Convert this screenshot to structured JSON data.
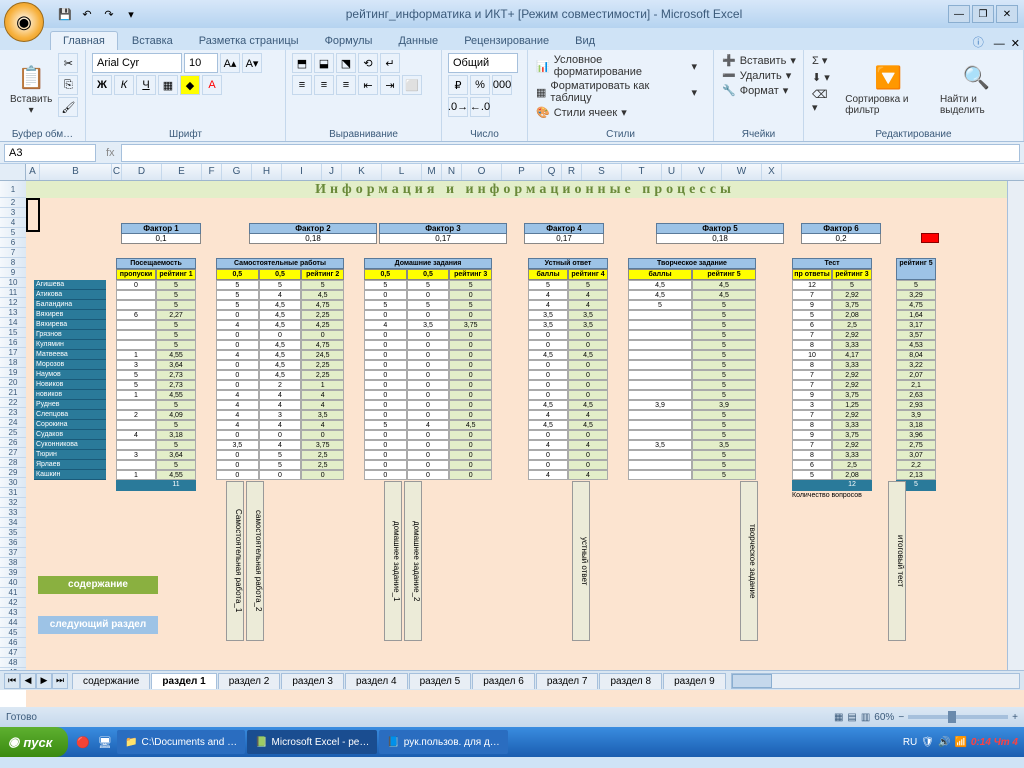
{
  "title": "рейтинг_информатика и ИКТ+  [Режим совместимости] - Microsoft Excel",
  "tabs": {
    "home": "Главная",
    "insert": "Вставка",
    "layout": "Разметка страницы",
    "formulas": "Формулы",
    "data": "Данные",
    "review": "Рецензирование",
    "view": "Вид"
  },
  "groups": {
    "clipboard": "Буфер обм…",
    "paste": "Вставить",
    "font": "Шрифт",
    "align": "Выравнивание",
    "number": "Число",
    "styles": "Стили",
    "cells": "Ячейки",
    "editing": "Редактирование"
  },
  "font": {
    "name": "Arial Cyr",
    "size": "10"
  },
  "numfmt": "Общий",
  "styles": {
    "cond": "Условное форматирование",
    "table": "Форматировать как таблицу",
    "cell": "Стили ячеек"
  },
  "cells": {
    "insert": "Вставить",
    "delete": "Удалить",
    "format": "Формат"
  },
  "edit": {
    "sort": "Сортировка и фильтр",
    "find": "Найти и выделить"
  },
  "namebox": "A3",
  "cols": [
    "A",
    "B",
    "C",
    "D",
    "E",
    "F",
    "G",
    "H",
    "I",
    "J",
    "K",
    "L",
    "M",
    "N",
    "O",
    "P",
    "Q",
    "R",
    "S",
    "T",
    "U",
    "V",
    "W",
    "X"
  ],
  "maintitle": "Информация  и  информационные   процессы",
  "factors": [
    {
      "label": "Фактор 1",
      "val": "0,1"
    },
    {
      "label": "Фактор 2",
      "val": "0,18"
    },
    {
      "label": "Фактор 3",
      "val": "0,17"
    },
    {
      "label": "Фактор 4",
      "val": "0,17"
    },
    {
      "label": "Фактор 5",
      "val": "0,18"
    },
    {
      "label": "Фактор 6",
      "val": "0,2"
    }
  ],
  "names": [
    "Агишева",
    "Атикова",
    "Баландина",
    "Вяхирев",
    "Вяхирева",
    "Грязнов",
    "Кулямин",
    "Матвеева",
    "Морозов",
    "Наумов",
    "Новиков",
    "новиков",
    "Руднев",
    "Слепцова",
    "Сорокина",
    "Судаков",
    "Суконникова",
    "Тюрин",
    "Ярлаев",
    "Кашкин"
  ],
  "t1": {
    "hdr": "Посещаемость",
    "sub": [
      "пропуски",
      "рейтинг 1"
    ],
    "foot": [
      "",
      "11"
    ],
    "rows": [
      [
        "0",
        "5"
      ],
      [
        "",
        "5"
      ],
      [
        "",
        "5"
      ],
      [
        "6",
        "2,27"
      ],
      [
        "",
        "5"
      ],
      [
        "",
        "5"
      ],
      [
        "",
        "5"
      ],
      [
        "1",
        "4,55"
      ],
      [
        "3",
        "3,64"
      ],
      [
        "5",
        "2,73"
      ],
      [
        "5",
        "2,73"
      ],
      [
        "1",
        "4,55"
      ],
      [
        "",
        "5"
      ],
      [
        "2",
        "4,09"
      ],
      [
        "",
        "5"
      ],
      [
        "4",
        "3,18"
      ],
      [
        "",
        "5"
      ],
      [
        "3",
        "3,64"
      ],
      [
        "",
        "5"
      ],
      [
        "1",
        "4,55"
      ]
    ]
  },
  "t2": {
    "hdr": "Самостоятельные работы",
    "sub": [
      "0,5",
      "0,5",
      "рейтинг 2"
    ],
    "rows": [
      [
        "5",
        "5",
        "5"
      ],
      [
        "5",
        "4",
        "4,5"
      ],
      [
        "5",
        "4,5",
        "4,75"
      ],
      [
        "0",
        "4,5",
        "2,25"
      ],
      [
        "4",
        "4,5",
        "4,25"
      ],
      [
        "0",
        "0",
        "0"
      ],
      [
        "0",
        "4,5",
        "4,75"
      ],
      [
        "4",
        "4,5",
        "24,5"
      ],
      [
        "0",
        "4,5",
        "2,25"
      ],
      [
        "0",
        "4,5",
        "2,25"
      ],
      [
        "0",
        "2",
        "1"
      ],
      [
        "4",
        "4",
        "4"
      ],
      [
        "4",
        "4",
        "4"
      ],
      [
        "4",
        "3",
        "3,5"
      ],
      [
        "4",
        "4",
        "4"
      ],
      [
        "0",
        "0",
        "0"
      ],
      [
        "3,5",
        "4",
        "3,75"
      ],
      [
        "0",
        "5",
        "2,5"
      ],
      [
        "0",
        "5",
        "2,5"
      ],
      [
        "0",
        "0",
        "0"
      ]
    ]
  },
  "t3": {
    "hdr": "Домашние задания",
    "sub": [
      "0,5",
      "0,5",
      "рейтинг 3"
    ],
    "rows": [
      [
        "5",
        "5",
        "5"
      ],
      [
        "0",
        "0",
        "0"
      ],
      [
        "5",
        "5",
        "5"
      ],
      [
        "0",
        "0",
        "0"
      ],
      [
        "4",
        "3,5",
        "3,75"
      ],
      [
        "0",
        "0",
        "0"
      ],
      [
        "0",
        "0",
        "0"
      ],
      [
        "0",
        "0",
        "0"
      ],
      [
        "0",
        "0",
        "0"
      ],
      [
        "0",
        "0",
        "0"
      ],
      [
        "0",
        "0",
        "0"
      ],
      [
        "0",
        "0",
        "0"
      ],
      [
        "0",
        "0",
        "0"
      ],
      [
        "0",
        "0",
        "0"
      ],
      [
        "5",
        "4",
        "4,5"
      ],
      [
        "0",
        "0",
        "0"
      ],
      [
        "0",
        "0",
        "0"
      ],
      [
        "0",
        "0",
        "0"
      ],
      [
        "0",
        "0",
        "0"
      ],
      [
        "0",
        "0",
        "0"
      ]
    ]
  },
  "t4": {
    "hdr": "Устный ответ",
    "sub": [
      "баллы",
      "рейтинг 4"
    ],
    "rows": [
      [
        "5",
        "5"
      ],
      [
        "4",
        "4"
      ],
      [
        "4",
        "4"
      ],
      [
        "3,5",
        "3,5"
      ],
      [
        "3,5",
        "3,5"
      ],
      [
        "0",
        "0"
      ],
      [
        "0",
        "0"
      ],
      [
        "4,5",
        "4,5"
      ],
      [
        "0",
        "0"
      ],
      [
        "0",
        "0"
      ],
      [
        "0",
        "0"
      ],
      [
        "0",
        "0"
      ],
      [
        "4,5",
        "4,5"
      ],
      [
        "4",
        "4"
      ],
      [
        "4,5",
        "4,5"
      ],
      [
        "0",
        "0"
      ],
      [
        "4",
        "4"
      ],
      [
        "0",
        "0"
      ],
      [
        "0",
        "0"
      ],
      [
        "4",
        "4"
      ]
    ]
  },
  "t5": {
    "hdr": "Творческое задание",
    "sub": [
      "баллы",
      "рейтинг 5"
    ],
    "rows": [
      [
        "4,5",
        "4,5"
      ],
      [
        "4,5",
        "4,5"
      ],
      [
        "5",
        "5"
      ],
      [
        "",
        "5"
      ],
      [
        "",
        "5"
      ],
      [
        "",
        "5"
      ],
      [
        "",
        "5"
      ],
      [
        "",
        "5"
      ],
      [
        "",
        "5"
      ],
      [
        "",
        "5"
      ],
      [
        "",
        "5"
      ],
      [
        "",
        "5"
      ],
      [
        "3,9",
        "3,9"
      ],
      [
        "",
        "5"
      ],
      [
        "",
        "5"
      ],
      [
        "",
        "5"
      ],
      [
        "3,5",
        "3,5"
      ],
      [
        "",
        "5"
      ],
      [
        "",
        "5"
      ],
      [
        "",
        "5"
      ]
    ]
  },
  "t6": {
    "hdr": "Тест",
    "sub": [
      "пр ответы",
      "рейтинг 3"
    ],
    "foot": [
      "",
      "12"
    ],
    "extra": "Количество вопросов",
    "rows": [
      [
        "12",
        "5"
      ],
      [
        "7",
        "2,92"
      ],
      [
        "9",
        "3,75"
      ],
      [
        "5",
        "2,08"
      ],
      [
        "6",
        "2,5"
      ],
      [
        "7",
        "2,92"
      ],
      [
        "8",
        "3,33"
      ],
      [
        "10",
        "4,17"
      ],
      [
        "8",
        "3,33"
      ],
      [
        "7",
        "2,92"
      ],
      [
        "7",
        "2,92"
      ],
      [
        "9",
        "3,75"
      ],
      [
        "3",
        "1,25"
      ],
      [
        "7",
        "2,92"
      ],
      [
        "8",
        "3,33"
      ],
      [
        "9",
        "3,75"
      ],
      [
        "7",
        "2,92"
      ],
      [
        "8",
        "3,33"
      ],
      [
        "6",
        "2,5"
      ],
      [
        "5",
        "2,08"
      ]
    ]
  },
  "rside": {
    "hdr": "рейтинг 5",
    "foot": "5",
    "vals": [
      "5",
      "3,29",
      "4,75",
      "1,64",
      "3,17",
      "3,57",
      "4,53",
      "8,04",
      "3,22",
      "2,07",
      "2,1",
      "2,63",
      "2,93",
      "3,9",
      "3,18",
      "3,96",
      "2,75",
      "3,07",
      "2,2",
      "2,13"
    ]
  },
  "vlabels": [
    "Самостоятельная работа_1",
    "самостоятельная работа_2",
    "домашнее задание_1",
    "домашнее задание_2",
    "устный ответ",
    "творческое задание",
    "итоговый тест"
  ],
  "btns": {
    "content": "содержание",
    "next": "следующий раздел"
  },
  "sheettabs": [
    "содержание",
    "раздел 1",
    "раздел 2",
    "раздел 3",
    "раздел 4",
    "раздел 5",
    "раздел 6",
    "раздел 7",
    "раздел 8",
    "раздел 9"
  ],
  "status": "Готово",
  "zoom": "60%",
  "taskbar": {
    "start": "пуск",
    "items": [
      "C:\\Documents and …",
      "Microsoft Excel - ре…",
      "рук.пользов. для д…"
    ],
    "lang": "RU",
    "time": "0:14 Чт 4"
  }
}
